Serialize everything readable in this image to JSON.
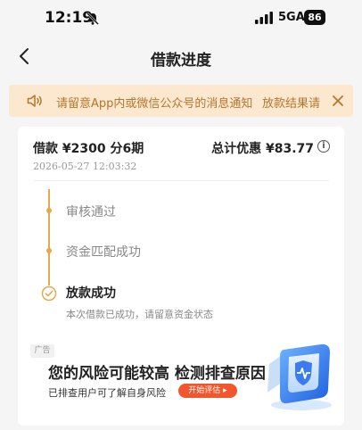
{
  "status_bar": {
    "time": "12:19",
    "network": "5GA",
    "battery": "86"
  },
  "nav": {
    "title": "借款进度"
  },
  "notice": {
    "text": "请留意App内或微信公众号的消息通知",
    "scroll_text": "放款结果请"
  },
  "loan": {
    "amount_text": "借款 ¥2300  分6期",
    "discount_text": "总计优惠 ¥83.77",
    "datetime": "2026-05-27 12:03:32"
  },
  "steps": [
    {
      "label": "审核通过",
      "state": "done"
    },
    {
      "label": "资金匹配成功",
      "state": "done"
    },
    {
      "label": "放款成功",
      "state": "current",
      "sub": "本次借款已成功，请留意资金状态"
    }
  ],
  "ad": {
    "tag": "广告",
    "title": "您的风险可能较高 检测排查原因",
    "subtitle": "已排查用户可了解自身风险",
    "button": "开始评估 ▸"
  },
  "colors": {
    "accent": "#e3a94e",
    "notice_bg": "#fbe8cf",
    "notice_text": "#b5762e",
    "ad_button": "#f2562c"
  }
}
